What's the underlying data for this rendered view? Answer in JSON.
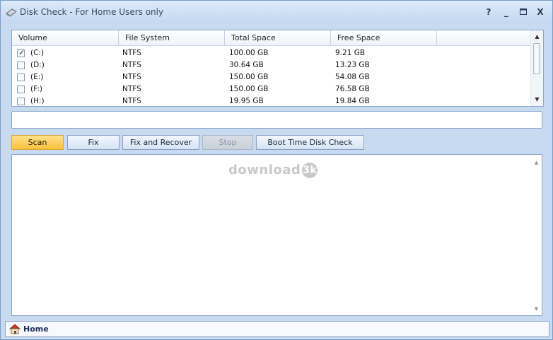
{
  "window": {
    "title": "Disk Check - For Home Users only",
    "buttons": {
      "help": "?",
      "minimize": "_",
      "maximize": "□",
      "close": "X"
    }
  },
  "volumes": {
    "columns": [
      "Volume",
      "File System",
      "Total Space",
      "Free Space"
    ],
    "rows": [
      {
        "volume": "(C:)",
        "file_system": "NTFS",
        "total": "100.00 GB",
        "free": "9.21 GB",
        "checked": true
      },
      {
        "volume": "(D:)",
        "file_system": "NTFS",
        "total": "30.64 GB",
        "free": "13.23 GB",
        "checked": false
      },
      {
        "volume": "(E:)",
        "file_system": "NTFS",
        "total": "150.00 GB",
        "free": "54.08 GB",
        "checked": false
      },
      {
        "volume": "(F:)",
        "file_system": "NTFS",
        "total": "150.00 GB",
        "free": "76.58 GB",
        "checked": false
      },
      {
        "volume": "(H:)",
        "file_system": "NTFS",
        "total": "19.95 GB",
        "free": "19.84 GB",
        "checked": false
      }
    ]
  },
  "toolbar": {
    "scan": "Scan",
    "fix": "Fix",
    "fix_recover": "Fix and Recover",
    "stop": "Stop",
    "boot_check": "Boot Time Disk Check"
  },
  "watermark": {
    "text": "download",
    "badge": "3k"
  },
  "status": {
    "home": "Home"
  },
  "colors": {
    "accent": "#f8c13d",
    "frame": "#c8daf0",
    "border": "#8aa6c8"
  }
}
